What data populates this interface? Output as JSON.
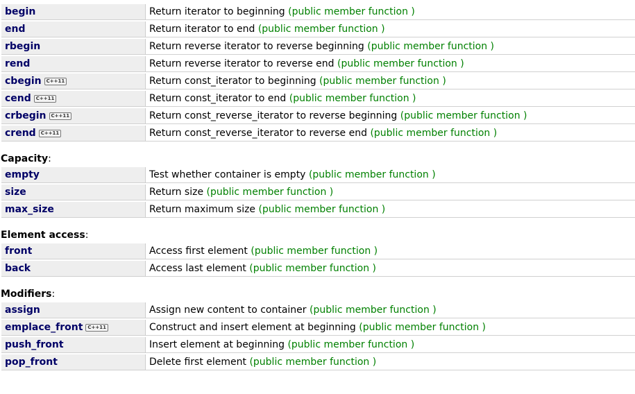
{
  "groups": [
    {
      "title": "",
      "members": [
        {
          "name": "begin",
          "cpp11": "",
          "desc": "Return iterator to beginning",
          "kind": "(public member function )"
        },
        {
          "name": "end",
          "cpp11": "",
          "desc": "Return iterator to end",
          "kind": "(public member function )"
        },
        {
          "name": "rbegin",
          "cpp11": "",
          "desc": "Return reverse iterator to reverse beginning",
          "kind": "(public member function )"
        },
        {
          "name": "rend",
          "cpp11": "",
          "desc": "Return reverse iterator to reverse end",
          "kind": "(public member function )"
        },
        {
          "name": "cbegin",
          "cpp11": "C++11",
          "desc": "Return const_iterator to beginning",
          "kind": "(public member function )"
        },
        {
          "name": "cend",
          "cpp11": "C++11",
          "desc": "Return const_iterator to end",
          "kind": "(public member function )"
        },
        {
          "name": "crbegin",
          "cpp11": "C++11",
          "desc": "Return const_reverse_iterator to reverse beginning",
          "kind": "(public member function )"
        },
        {
          "name": "crend",
          "cpp11": "C++11",
          "desc": "Return const_reverse_iterator to reverse end",
          "kind": "(public member function )"
        }
      ]
    },
    {
      "title": "Capacity",
      "members": [
        {
          "name": "empty",
          "cpp11": "",
          "desc": "Test whether container is empty",
          "kind": "(public member function )"
        },
        {
          "name": "size",
          "cpp11": "",
          "desc": "Return size",
          "kind": "(public member function )"
        },
        {
          "name": "max_size",
          "cpp11": "",
          "desc": "Return maximum size",
          "kind": "(public member function )"
        }
      ]
    },
    {
      "title": "Element access",
      "members": [
        {
          "name": "front",
          "cpp11": "",
          "desc": "Access first element",
          "kind": "(public member function )"
        },
        {
          "name": "back",
          "cpp11": "",
          "desc": "Access last element",
          "kind": "(public member function )"
        }
      ]
    },
    {
      "title": "Modifiers",
      "members": [
        {
          "name": "assign",
          "cpp11": "",
          "desc": "Assign new content to container",
          "kind": "(public member function )"
        },
        {
          "name": "emplace_front",
          "cpp11": "C++11",
          "desc": "Construct and insert element at beginning",
          "kind": "(public member function )"
        },
        {
          "name": "push_front",
          "cpp11": "",
          "desc": "Insert element at beginning",
          "kind": "(public member function )"
        },
        {
          "name": "pop_front",
          "cpp11": "",
          "desc": "Delete first element",
          "kind": "(public member function )"
        }
      ]
    }
  ],
  "colors": {
    "name_cell_bg": "#eeeeee",
    "name_text": "#000066",
    "kind_text": "#008000"
  }
}
